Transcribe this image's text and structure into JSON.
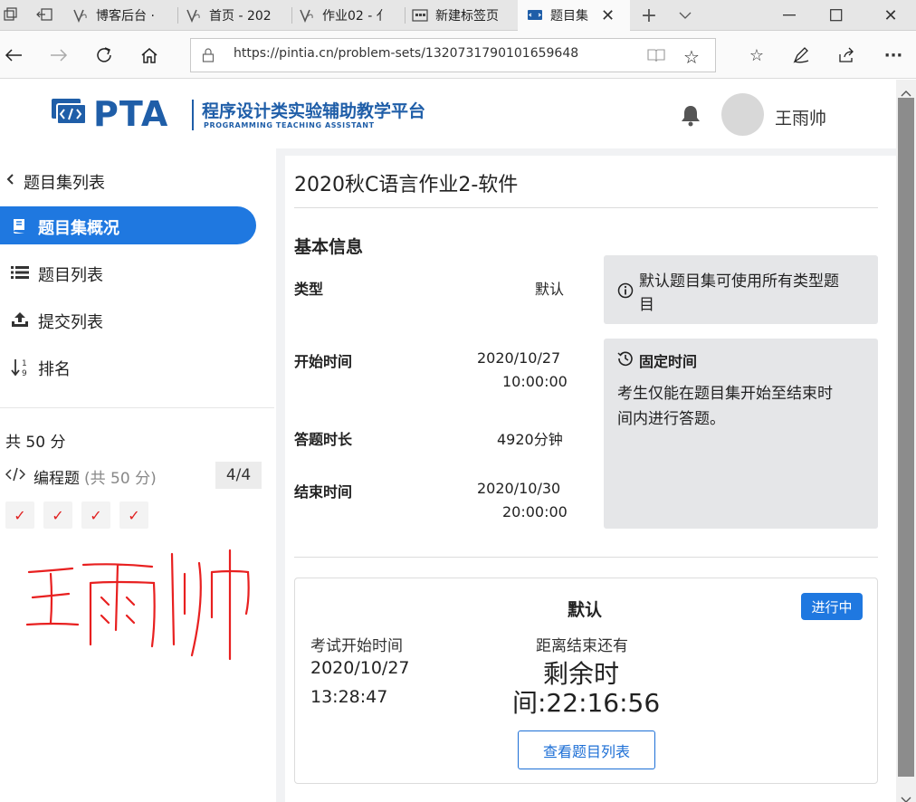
{
  "browser": {
    "tabs": [
      {
        "label": "博客后台 ·"
      },
      {
        "label": "首页 - 202"
      },
      {
        "label": "作业02 - 亻"
      },
      {
        "label": "新建标签页"
      },
      {
        "label": "题目集"
      }
    ],
    "url": "https://pintia.cn/problem-sets/1320731790101659648"
  },
  "header": {
    "logo_text": "PTA",
    "platform_name": "程序设计类实验辅助教学平台",
    "platform_subtitle": "PROGRAMMING TEACHING ASSISTANT",
    "username": "王雨帅"
  },
  "sidebar": {
    "back_label": "题目集列表",
    "nav": [
      {
        "label": "题目集概况",
        "active": true,
        "icon": "book-icon"
      },
      {
        "label": "题目列表",
        "active": false,
        "icon": "list-icon"
      },
      {
        "label": "提交列表",
        "active": false,
        "icon": "upload-icon"
      },
      {
        "label": "排名",
        "active": false,
        "icon": "sort-numeric-icon"
      }
    ],
    "total_score": "共 50 分",
    "category_label": "编程题",
    "category_score": "(共 50 分)",
    "category_count": "4/4",
    "problem_checks": [
      "✓",
      "✓",
      "✓",
      "✓"
    ],
    "handwritten_name": "王雨帅"
  },
  "main": {
    "title": "2020秋C语言作业2-软件",
    "section_title": "基本信息",
    "rows": [
      {
        "label": "类型",
        "value_line1": "默认",
        "value_line2": ""
      },
      {
        "label": "开始时间",
        "value_line1": "2020/10/27",
        "value_line2": "10:00:00"
      },
      {
        "label": "答题时长",
        "value_line1": "4920分钟",
        "value_line2": ""
      },
      {
        "label": "结束时间",
        "value_line1": "2020/10/30",
        "value_line2": "20:00:00"
      }
    ],
    "info_type_line1": "默认题目集可使用所有类型题",
    "info_type_line2": "目",
    "info_fixed_title": "固定时间",
    "info_fixed_line1": "考生仅能在题目集开始至结束时",
    "info_fixed_line2": "间内进行答题。"
  },
  "exam_card": {
    "title": "默认",
    "status_badge": "进行中",
    "start_label": "考试开始时间",
    "start_date": "2020/10/27",
    "start_time": "13:28:47",
    "remaining_label": "距离结束还有",
    "remaining_line1": "剩余时",
    "remaining_line2": "间:22:16:56",
    "view_button": "查看题目列表"
  },
  "colors": {
    "accent": "#1f78e0",
    "check_red": "#e02020",
    "content_bg": "#f1f2f4",
    "info_box": "#e5e6e8"
  }
}
